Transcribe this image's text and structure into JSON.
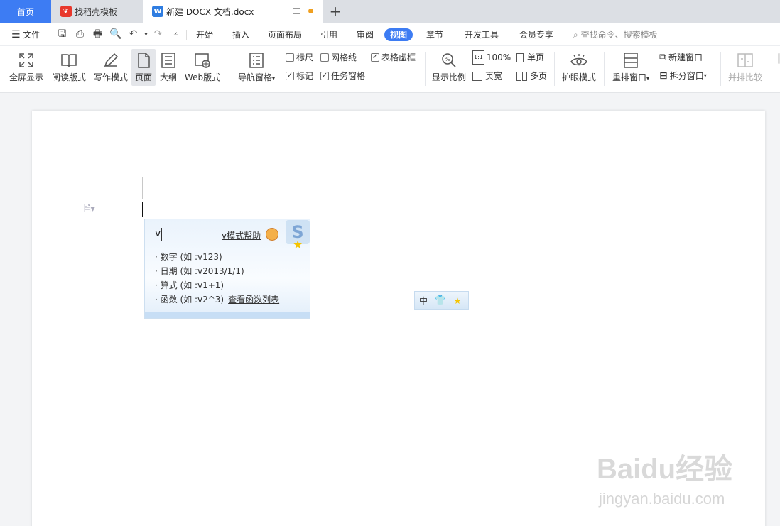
{
  "tabs": [
    {
      "label": "首页",
      "active": false
    },
    {
      "label": "找稻壳模板",
      "active": false
    },
    {
      "label": "新建 DOCX 文档.docx",
      "active": true
    }
  ],
  "menu": {
    "file_label": "文件",
    "items": [
      "开始",
      "插入",
      "页面布局",
      "引用",
      "审阅",
      "视图",
      "章节",
      "开发工具",
      "会员专享"
    ],
    "active_item": "视图",
    "search_placeholder": "查找命令、搜索模板"
  },
  "ribbon": {
    "fullscreen": "全屏显示",
    "reading": "阅读版式",
    "writing": "写作模式",
    "page": "页面",
    "outline": "大纲",
    "web": "Web版式",
    "navigation": "导航窗格",
    "ruler": "标尺",
    "gridlines": "网格线",
    "table_gridlines": "表格虚框",
    "marks": "标记",
    "task_pane": "任务窗格",
    "zoom": "显示比例",
    "zoom_100": "100%",
    "single_page": "单页",
    "page_width": "页宽",
    "multi_page": "多页",
    "eye_mode": "护眼模式",
    "rearrange": "重排窗口",
    "new_window": "新建窗口",
    "split_window": "拆分窗口",
    "side_by_side": "并排比较",
    "checked": {
      "ruler": false,
      "gridlines": false,
      "table_gridlines": true,
      "marks": true,
      "task_pane": true
    }
  },
  "ime": {
    "input": "v",
    "help_label": "v模式帮助",
    "rows": [
      "· 数字 (如 :v123)",
      "· 日期 (如 :v2013/1/1)",
      "· 算式 (如 :v1+1)",
      "· 函数 (如 :v2^3)"
    ],
    "function_link": "查看函数列表",
    "logo": "S",
    "status_lang": "中"
  },
  "watermark": {
    "main": "Baidu经验",
    "sub": "jingyan.baidu.com"
  }
}
